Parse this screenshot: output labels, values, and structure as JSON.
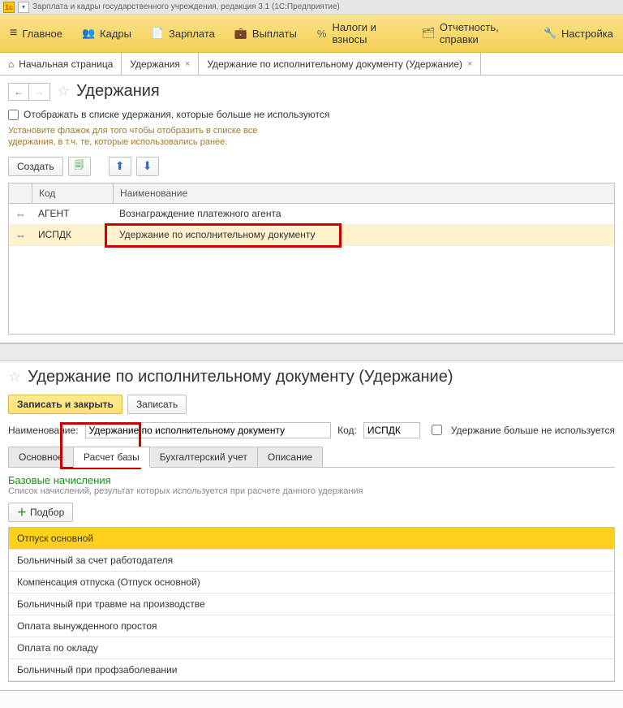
{
  "titlebar": {
    "text": "Зарплата и кадры государственного учреждения, редакция 3.1  (1С:Предприятие)"
  },
  "mainmenu": [
    {
      "icon": "≡",
      "label": "Главное"
    },
    {
      "icon": "👥",
      "label": "Кадры"
    },
    {
      "icon": "📄",
      "label": "Зарплата"
    },
    {
      "icon": "💼",
      "label": "Выплаты"
    },
    {
      "icon": "%",
      "label": "Налоги и взносы"
    },
    {
      "icon": "🗂",
      "label": "Отчетность, справки"
    },
    {
      "icon": "🔧",
      "label": "Настройка"
    }
  ],
  "navtabs": {
    "home": {
      "label": "Начальная страница"
    },
    "tab1": {
      "label": "Удержания"
    },
    "tab2": {
      "label": "Удержание по исполнительному документу (Удержание)"
    }
  },
  "pane1": {
    "title": "Удержания",
    "show_unused_label": "Отображать в списке удержания, которые больше не используются",
    "hint": "Установите флажок для того чтобы отобразить в списке все удержания, в т.ч. те, которые использовались ранее.",
    "create": "Создать",
    "columns": {
      "code": "Код",
      "name": "Наименование"
    },
    "rows": [
      {
        "code": "АГЕНТ",
        "name": "Вознаграждение платежного агента"
      },
      {
        "code": "ИСПДК",
        "name": "Удержание по исполнительному документу"
      }
    ]
  },
  "pane2": {
    "title": "Удержание по исполнительному документу (Удержание)",
    "save_close": "Записать и закрыть",
    "save": "Записать",
    "label_name": "Наименование:",
    "value_name": "Удержание по исполнительному документу",
    "label_code": "Код:",
    "value_code": "ИСПДК",
    "unused_label": "Удержание больше не используется",
    "tabs": [
      "Основное",
      "Расчет базы",
      "Бухгалтерский учет",
      "Описание"
    ],
    "base_title": "Базовые начисления",
    "base_hint": "Список начислений, результат которых используется при расчете данного удержания",
    "pick": "Подбор",
    "base_rows": [
      "Отпуск основной",
      "Больничный за счет работодателя",
      "Компенсация отпуска (Отпуск основной)",
      "Больничный при травме на производстве",
      "Оплата вынужденного простоя",
      "Оплата по окладу",
      "Больничный при профзаболевании"
    ]
  }
}
